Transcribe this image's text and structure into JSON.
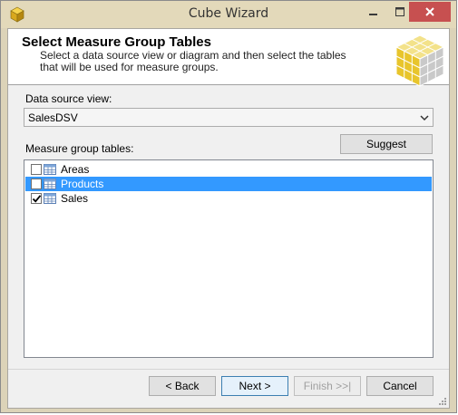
{
  "window": {
    "title": "Cube Wizard",
    "controls": {
      "minimize": "minimize",
      "maximize": "maximize",
      "close": "close"
    }
  },
  "header": {
    "title": "Select Measure Group Tables",
    "subtitle": "Select a data source view or diagram and then select the tables that will be used for measure groups."
  },
  "data_source": {
    "label": "Data source view:",
    "selected": "SalesDSV"
  },
  "measure_tables": {
    "label": "Measure group tables:",
    "suggest_label": "Suggest",
    "items": [
      {
        "name": "Areas",
        "checked": false,
        "selected": false
      },
      {
        "name": "Products",
        "checked": false,
        "selected": true
      },
      {
        "name": "Sales",
        "checked": true,
        "selected": false
      }
    ]
  },
  "footer": {
    "back": "< Back",
    "next": "Next >",
    "finish": "Finish >>|",
    "cancel": "Cancel"
  },
  "colors": {
    "titlebar": "#e3d9ba",
    "close_button": "#c75050",
    "selection": "#3399ff"
  }
}
